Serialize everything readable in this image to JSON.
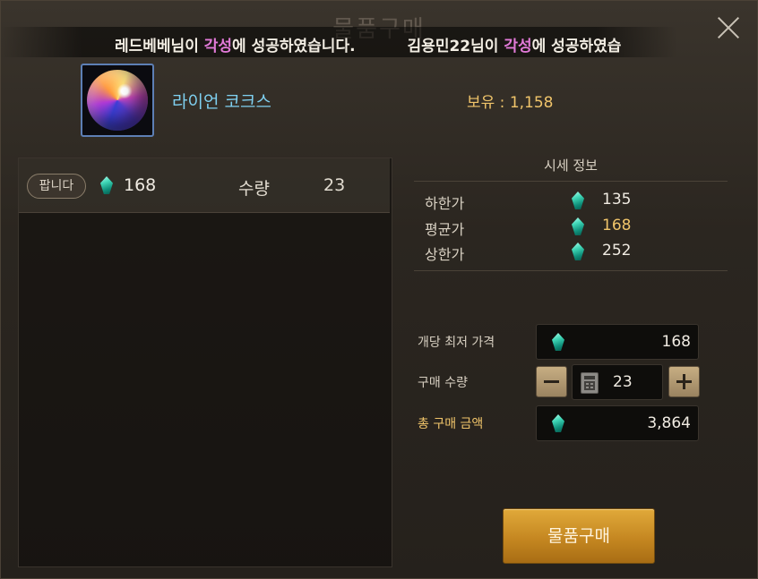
{
  "window": {
    "title": "물품구매"
  },
  "ticker": {
    "messages": [
      {
        "prefix": "레드베베님이 ",
        "highlight": "각성",
        "suffix": "에 성공하였습니다."
      },
      {
        "prefix": "김용민22님이 ",
        "highlight": "각성",
        "suffix": "에 성공하였습"
      }
    ]
  },
  "item": {
    "name": "라이언 코크스",
    "owned_label": "보유 : 1,158",
    "icon": "orb-icon"
  },
  "listing": {
    "badge": "팝니다",
    "price": "168",
    "qty_label": "수량",
    "qty": "23",
    "icon": "gem-icon"
  },
  "market": {
    "title": "시세 정보",
    "rows": [
      {
        "label": "하한가",
        "value": "135"
      },
      {
        "label": "평균가",
        "value": "168"
      },
      {
        "label": "상한가",
        "value": "252"
      }
    ]
  },
  "order": {
    "unit_price_label": "개당 최저 가격",
    "unit_price": "168",
    "quantity_label": "구매 수량",
    "quantity": "23",
    "total_label": "총 구매 금액",
    "total": "3,864"
  },
  "buy_button": {
    "label": "물품구매"
  },
  "colors": {
    "accent_gold": "#f0c46a",
    "item_name": "#7fd0f0",
    "highlight": "#e27ad8",
    "button": "#c58721"
  }
}
